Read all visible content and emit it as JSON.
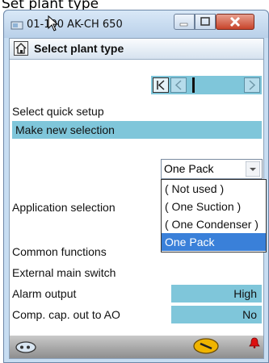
{
  "caption": "Set plant type",
  "window": {
    "title": "01-100 AK-CH 650"
  },
  "toolbar": {
    "title": "Select plant type"
  },
  "form": {
    "quick_setup_label": "Select quick setup",
    "make_new_selection": "Make new selection",
    "application_label": "Application selection",
    "application_value": "One Pack",
    "common_functions_label": "Common functions",
    "external_switch_label": "External main switch",
    "alarm_output_label": "Alarm output",
    "alarm_output_value": "High",
    "comp_cap_label": "Comp. cap. out to AO",
    "comp_cap_value": "No"
  },
  "dropdown": {
    "options": [
      "( Not used )",
      "( One Suction )",
      "( One Condenser )",
      "One Pack"
    ],
    "selected": "One Pack"
  },
  "colors": {
    "accent": "#7fc6da",
    "selection": "#3a80d9"
  }
}
